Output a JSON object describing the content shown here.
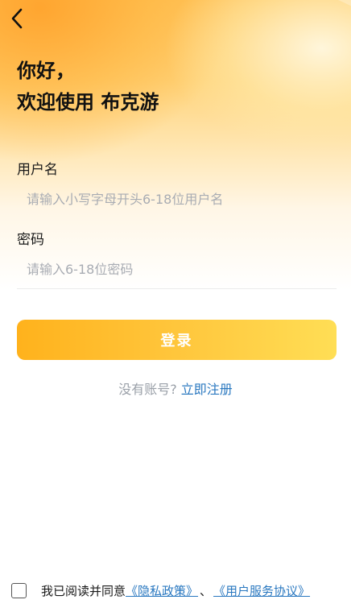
{
  "header": {
    "back_icon": "chevron-left-icon",
    "greeting_line1": "你好，",
    "greeting_line2": "欢迎使用 布克游"
  },
  "form": {
    "username": {
      "label": "用户名",
      "placeholder": "请输入小写字母开头6-18位用户名",
      "value": ""
    },
    "password": {
      "label": "密码",
      "placeholder": "请输入6-18位密码",
      "value": ""
    },
    "login_label": "登录"
  },
  "register": {
    "prompt": "没有账号?",
    "link": "立即注册"
  },
  "agreement": {
    "checked": false,
    "text": "我已阅读并同意",
    "privacy_link": "《隐私政策》",
    "separator": "、",
    "terms_link": "《用户服务协议》"
  },
  "colors": {
    "accent": "#FFC63C",
    "link": "#2A78C0",
    "placeholder": "#A8ACB3"
  }
}
